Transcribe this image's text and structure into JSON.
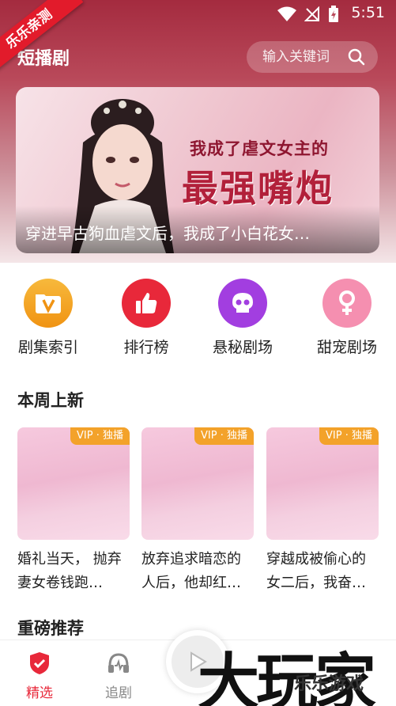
{
  "status_bar": {
    "time": "5:51",
    "wifi_icon": "wifi-icon",
    "signal_icon": "no-signal-icon",
    "battery_icon": "battery-charging-icon"
  },
  "ribbon": {
    "text": "乐乐亲测"
  },
  "header": {
    "title": "短播剧",
    "search_placeholder": "输入关键词"
  },
  "banner": {
    "headline_small": "我成了虐文女主的",
    "headline_big": "最强嘴炮",
    "caption": "穿进早古狗血虐文后，我成了小白花女…"
  },
  "categories": [
    {
      "label": "剧集索引",
      "icon": "video-folder-icon",
      "color": "#f5a425"
    },
    {
      "label": "排行榜",
      "icon": "thumbs-up-icon",
      "color": "#e8283a"
    },
    {
      "label": "悬秘剧场",
      "icon": "skull-icon",
      "color": "#a23ee0"
    },
    {
      "label": "甜宠剧场",
      "icon": "female-symbol-icon",
      "color": "#f58fb0"
    }
  ],
  "section_new": {
    "title": "本周上新",
    "items": [
      {
        "badge": "VIP · 独播",
        "title": "婚礼当天， 抛弃妻女卷钱跑…"
      },
      {
        "badge": "VIP · 独播",
        "title": "放弃追求暗恋的人后，他却红…"
      },
      {
        "badge": "VIP · 独播",
        "title": "穿越成被偷心的女二后，我奋…"
      }
    ]
  },
  "section_recommend": {
    "title": "重磅推荐"
  },
  "bottom_nav": {
    "items": [
      {
        "label": "精选",
        "icon": "shield-check-icon",
        "active": true
      },
      {
        "label": "追剧",
        "icon": "headphones-icon",
        "active": false
      }
    ],
    "play_icon": "play-icon"
  },
  "watermark": {
    "text": "大玩家",
    "sub": "乐乐游戏"
  },
  "colors": {
    "accent": "#e8283a",
    "header": "#a42b3f",
    "badge": "#f3a22a"
  }
}
